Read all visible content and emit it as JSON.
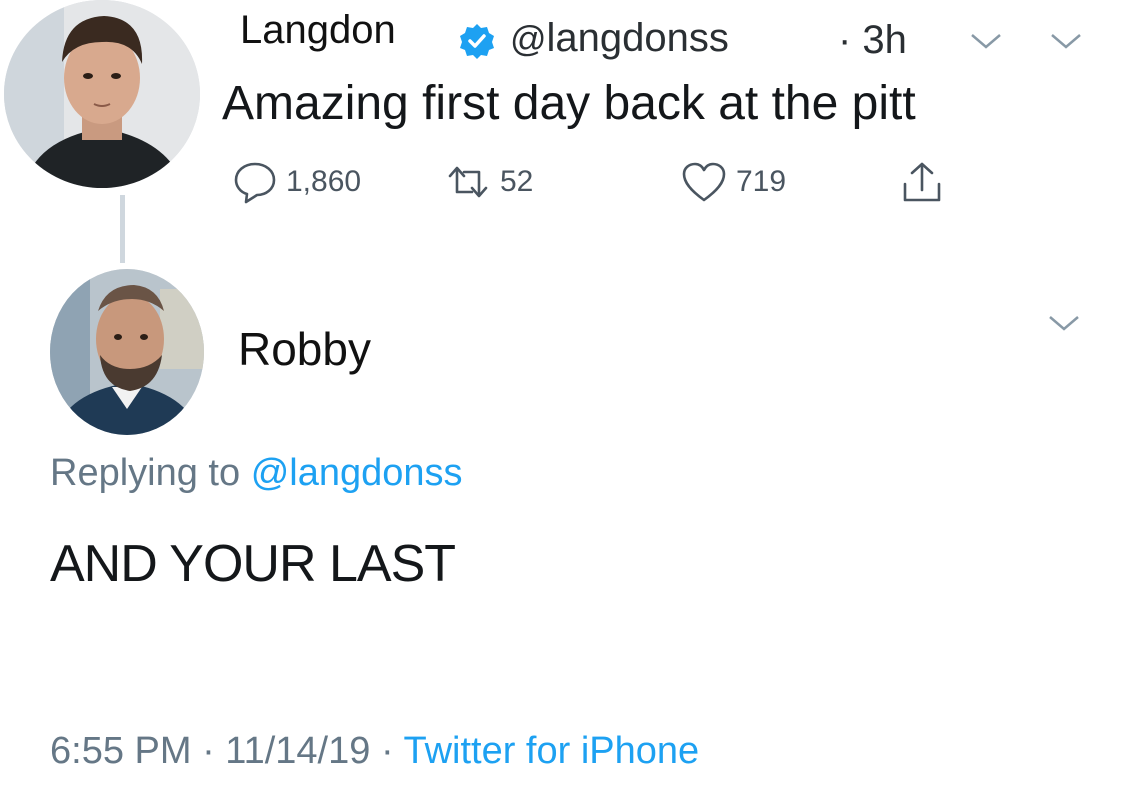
{
  "tweet": {
    "author_name": "Langdon",
    "handle_at": "@",
    "handle": "langdonss",
    "time": "· 3h",
    "text": "Amazing first day back at the pitt",
    "replies": "1,860",
    "retweets": "52",
    "likes": "719"
  },
  "reply": {
    "author_name": "Robby",
    "replying_prefix": "Replying to",
    "replying_handle": "@langdonss",
    "text": "AND YOUR LAST",
    "timestamp": "6:55 PM · 11/14/19 · ",
    "source": "Twitter for iPhone"
  },
  "colors": {
    "link": "#1da1f2",
    "verified": "#1da1f2",
    "muted": "#657786"
  },
  "icons": [
    "verified-badge-icon",
    "chevron-down-icon",
    "reply-icon",
    "retweet-icon",
    "like-icon",
    "share-icon"
  ]
}
